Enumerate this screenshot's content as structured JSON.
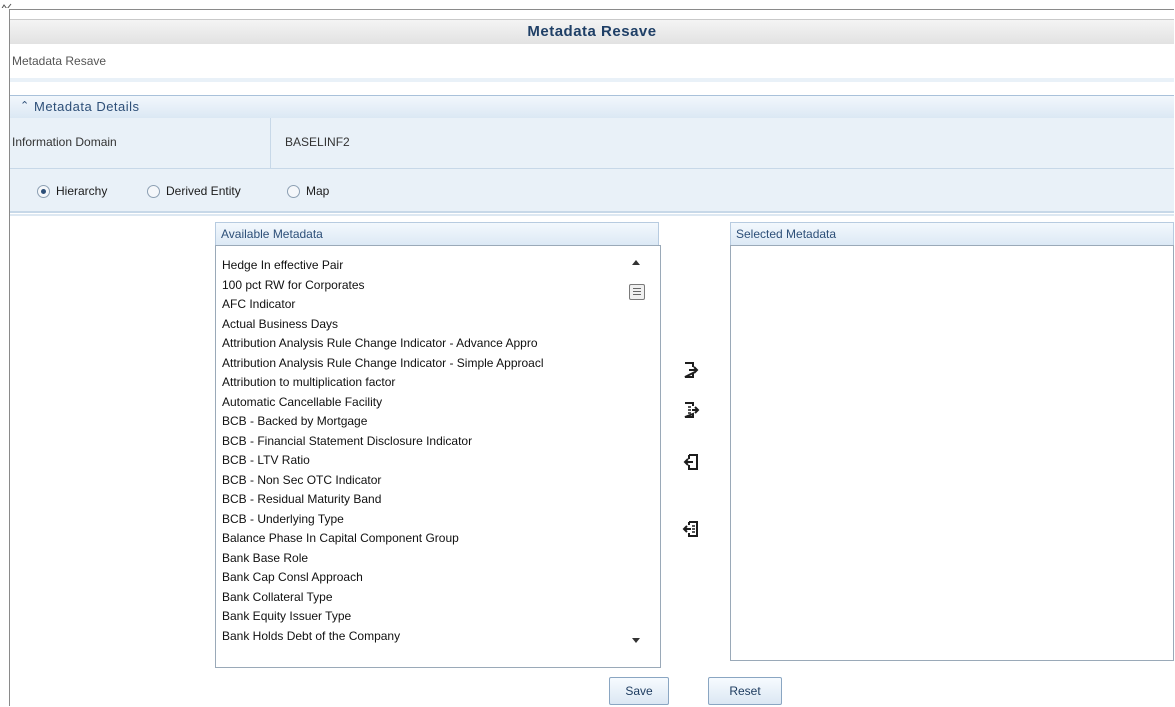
{
  "page": {
    "title": "Metadata Resave",
    "breadcrumb": "Metadata Resave"
  },
  "details": {
    "section_title": "Metadata Details",
    "info_domain_label": "Information Domain",
    "info_domain_value": "BASELINF2"
  },
  "metadata_type": {
    "options": [
      "Hierarchy",
      "Derived Entity",
      "Map"
    ],
    "selected": "Hierarchy"
  },
  "available": {
    "header": "Available Metadata",
    "items": [
      "Hedge In effective Pair",
      "100 pct RW for Corporates",
      "AFC Indicator",
      "Actual Business Days",
      "Attribution Analysis Rule Change Indicator - Advance Appro",
      "Attribution Analysis Rule Change Indicator - Simple Approacl",
      "Attribution to multiplication factor",
      "Automatic Cancellable Facility",
      "BCB - Backed by Mortgage",
      "BCB - Financial Statement Disclosure Indicator",
      "BCB - LTV Ratio",
      "BCB - Non Sec OTC Indicator",
      "BCB - Residual Maturity Band",
      "BCB - Underlying Type",
      "Balance Phase In Capital Component Group",
      "Bank Base Role",
      "Bank Cap Consl Approach",
      "Bank Collateral Type",
      "Bank Equity Issuer Type",
      "Bank Holds Debt of the Company"
    ]
  },
  "selected_panel": {
    "header": "Selected Metadata",
    "items": []
  },
  "move_buttons": [
    "move-selected-right-icon",
    "move-all-right-icon",
    "move-selected-left-icon",
    "move-all-left-icon"
  ],
  "actions": {
    "save": "Save",
    "reset": "Reset"
  },
  "colors": {
    "title_text": "#1f3f66",
    "header_band": "#e9f1f8",
    "section_border": "#a9c1da"
  }
}
